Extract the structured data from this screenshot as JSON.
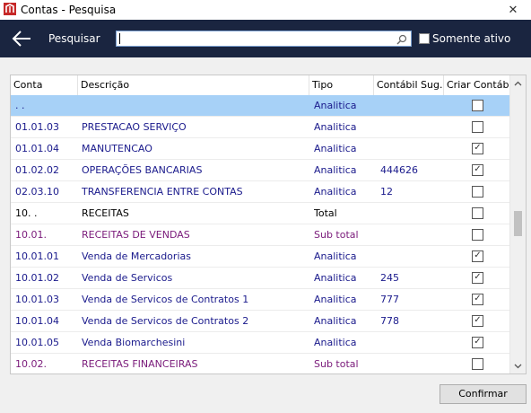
{
  "window": {
    "title": "Contas - Pesquisa",
    "close_glyph": "✕",
    "icon": "app-logo-icon"
  },
  "toolbar": {
    "back_icon": "arrow-left-icon",
    "search_label": "Pesquisar",
    "search_value": "",
    "search_icon": "magnifier-icon",
    "active_only_label": "Somente ativo",
    "active_only_checked": false
  },
  "grid": {
    "columns": [
      "Conta",
      "Descrição",
      "Tipo",
      "Contábil Sug.",
      "Criar Contábil"
    ],
    "rows": [
      {
        "conta": ". .",
        "descricao": "",
        "tipo": "Analitica",
        "contabil": "",
        "criar": false,
        "selected": true
      },
      {
        "conta": "01.01.03",
        "descricao": "PRESTACAO SERVIÇO",
        "tipo": "Analitica",
        "contabil": "",
        "criar": false
      },
      {
        "conta": "01.01.04",
        "descricao": "MANUTENCAO",
        "tipo": "Analitica",
        "contabil": "",
        "criar": true
      },
      {
        "conta": "01.02.02",
        "descricao": "OPERAÇÕES BANCARIAS",
        "tipo": "Analitica",
        "contabil": "444626",
        "criar": true
      },
      {
        "conta": "02.03.10",
        "descricao": "TRANSFERENCIA ENTRE CONTAS",
        "tipo": "Analitica",
        "contabil": "12",
        "criar": false
      },
      {
        "conta": "10. .",
        "descricao": "RECEITAS",
        "tipo": "Total",
        "contabil": "",
        "criar": false
      },
      {
        "conta": "10.01.",
        "descricao": "RECEITAS DE VENDAS",
        "tipo": "Sub total",
        "contabil": "",
        "criar": false
      },
      {
        "conta": "10.01.01",
        "descricao": "Venda de Mercadorias",
        "tipo": "Analitica",
        "contabil": "",
        "criar": true
      },
      {
        "conta": "10.01.02",
        "descricao": "Venda de Servicos",
        "tipo": "Analitica",
        "contabil": "245",
        "criar": true
      },
      {
        "conta": "10.01.03",
        "descricao": "Venda de Servicos de Contratos 1",
        "tipo": "Analitica",
        "contabil": "777",
        "criar": true
      },
      {
        "conta": "10.01.04",
        "descricao": "Venda de Servicos de Contratos 2",
        "tipo": "Analitica",
        "contabil": "778",
        "criar": true
      },
      {
        "conta": "10.01.05",
        "descricao": "Venda Biomarchesini",
        "tipo": "Analitica",
        "contabil": "",
        "criar": true
      },
      {
        "conta": "10.02.",
        "descricao": "RECEITAS FINANCEIRAS",
        "tipo": "Sub total",
        "contabil": "",
        "criar": false
      }
    ],
    "scroll_position": 0.48
  },
  "footer": {
    "confirm_label": "Confirmar"
  },
  "colors": {
    "toolbar_bg": "#1a2540",
    "analitica_text": "#1a1a8c",
    "subtotal_text": "#7a1a7a",
    "total_text": "#000000",
    "selected_row": "#a7d1f7"
  }
}
